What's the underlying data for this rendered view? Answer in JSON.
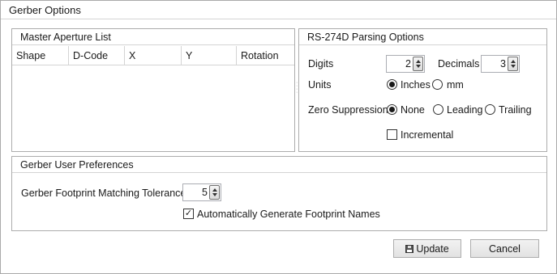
{
  "window": {
    "title": "Gerber Options"
  },
  "master_aperture": {
    "header": "Master Aperture List",
    "columns": [
      "Shape",
      "D-Code",
      "X",
      "Y",
      "Rotation"
    ]
  },
  "rs274d": {
    "header": "RS-274D Parsing Options",
    "digits_label": "Digits",
    "digits_value": "2",
    "decimals_label": "Decimals",
    "decimals_value": "3",
    "units_label": "Units",
    "units_options": [
      "Inches",
      "mm"
    ],
    "units_selected": "Inches",
    "zero_label": "Zero Suppression",
    "zero_options": [
      "None",
      "Leading",
      "Trailing"
    ],
    "zero_selected": "None",
    "incremental_label": "Incremental",
    "incremental_checked": false
  },
  "preferences": {
    "header": "Gerber User Preferences",
    "tolerance_label": "Gerber Footprint Matching Tolerance",
    "tolerance_value": "5",
    "auto_names_label": "Automatically Generate Footprint Names",
    "auto_names_checked": true
  },
  "buttons": {
    "update_label": "Update",
    "update_icon": "save-icon",
    "cancel_label": "Cancel"
  }
}
